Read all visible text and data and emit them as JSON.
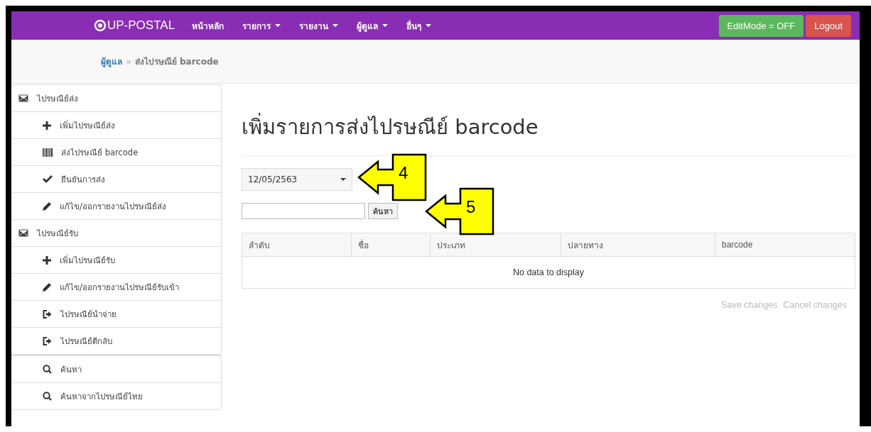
{
  "navbar": {
    "brand": "UP-POSTAL",
    "menu": [
      {
        "label": "หน้าหลัก",
        "dropdown": false
      },
      {
        "label": "รายการ",
        "dropdown": true
      },
      {
        "label": "รายงาน",
        "dropdown": true
      },
      {
        "label": "ผู้ดูแล",
        "dropdown": true
      },
      {
        "label": "อื่นๆ",
        "dropdown": true
      }
    ],
    "edit_mode_button": "EditMode = OFF",
    "logout_button": "Logout"
  },
  "breadcrumb": {
    "separator": "»",
    "items": [
      {
        "label": "ผู้ดูแล",
        "kind": "link"
      },
      {
        "label": "ส่งไปรษณีย์ barcode",
        "kind": "current"
      }
    ]
  },
  "sidebar": {
    "sections": [
      {
        "label": "ไปรษณีย์ส่ง",
        "children": [
          {
            "label": "เพิ่มไปรษณีย์ส่ง",
            "kind": "add"
          },
          {
            "label": "ส่งไปรษณีย์ barcode",
            "kind": "barcode"
          },
          {
            "label": "ยืนยันการส่ง",
            "kind": "confirm"
          },
          {
            "label": "แก้ไข/ออกรายงานไปรษณีย์ส่ง",
            "kind": "edit"
          }
        ]
      },
      {
        "label": "ไปรษณีย์รับ",
        "children": [
          {
            "label": "เพิ่มไปรษณีย์รับ",
            "kind": "add"
          },
          {
            "label": "แก้ไข/ออกรายงานไปรษณีย์รับเข้า",
            "kind": "edit"
          },
          {
            "label": "ไปรษณีย์นำจ่าย",
            "kind": "exit"
          },
          {
            "label": "ไปรษณีย์ตีกลับ",
            "kind": "exit"
          }
        ]
      }
    ],
    "tools": [
      {
        "label": "ค้นหา",
        "kind": "search"
      },
      {
        "label": "ค้นหาจากไปรษณีย์ไทย",
        "kind": "search"
      }
    ]
  },
  "page_title": "เพิ่มรายการส่งไปรษณีย์ barcode",
  "date_select": {
    "value": "12/05/2563"
  },
  "search_button": "ค้นหา",
  "table": {
    "columns": [
      "ลำดับ",
      "ชื่อ",
      "ประเภท",
      "ปลายทาง",
      "barcode"
    ],
    "empty_message": "No data to display"
  },
  "actions": [
    {
      "label": "Save changes",
      "disabled": true
    },
    {
      "label": "Cancel changes",
      "disabled": true
    }
  ],
  "callouts": [
    {
      "number": "4"
    },
    {
      "number": "5"
    }
  ]
}
